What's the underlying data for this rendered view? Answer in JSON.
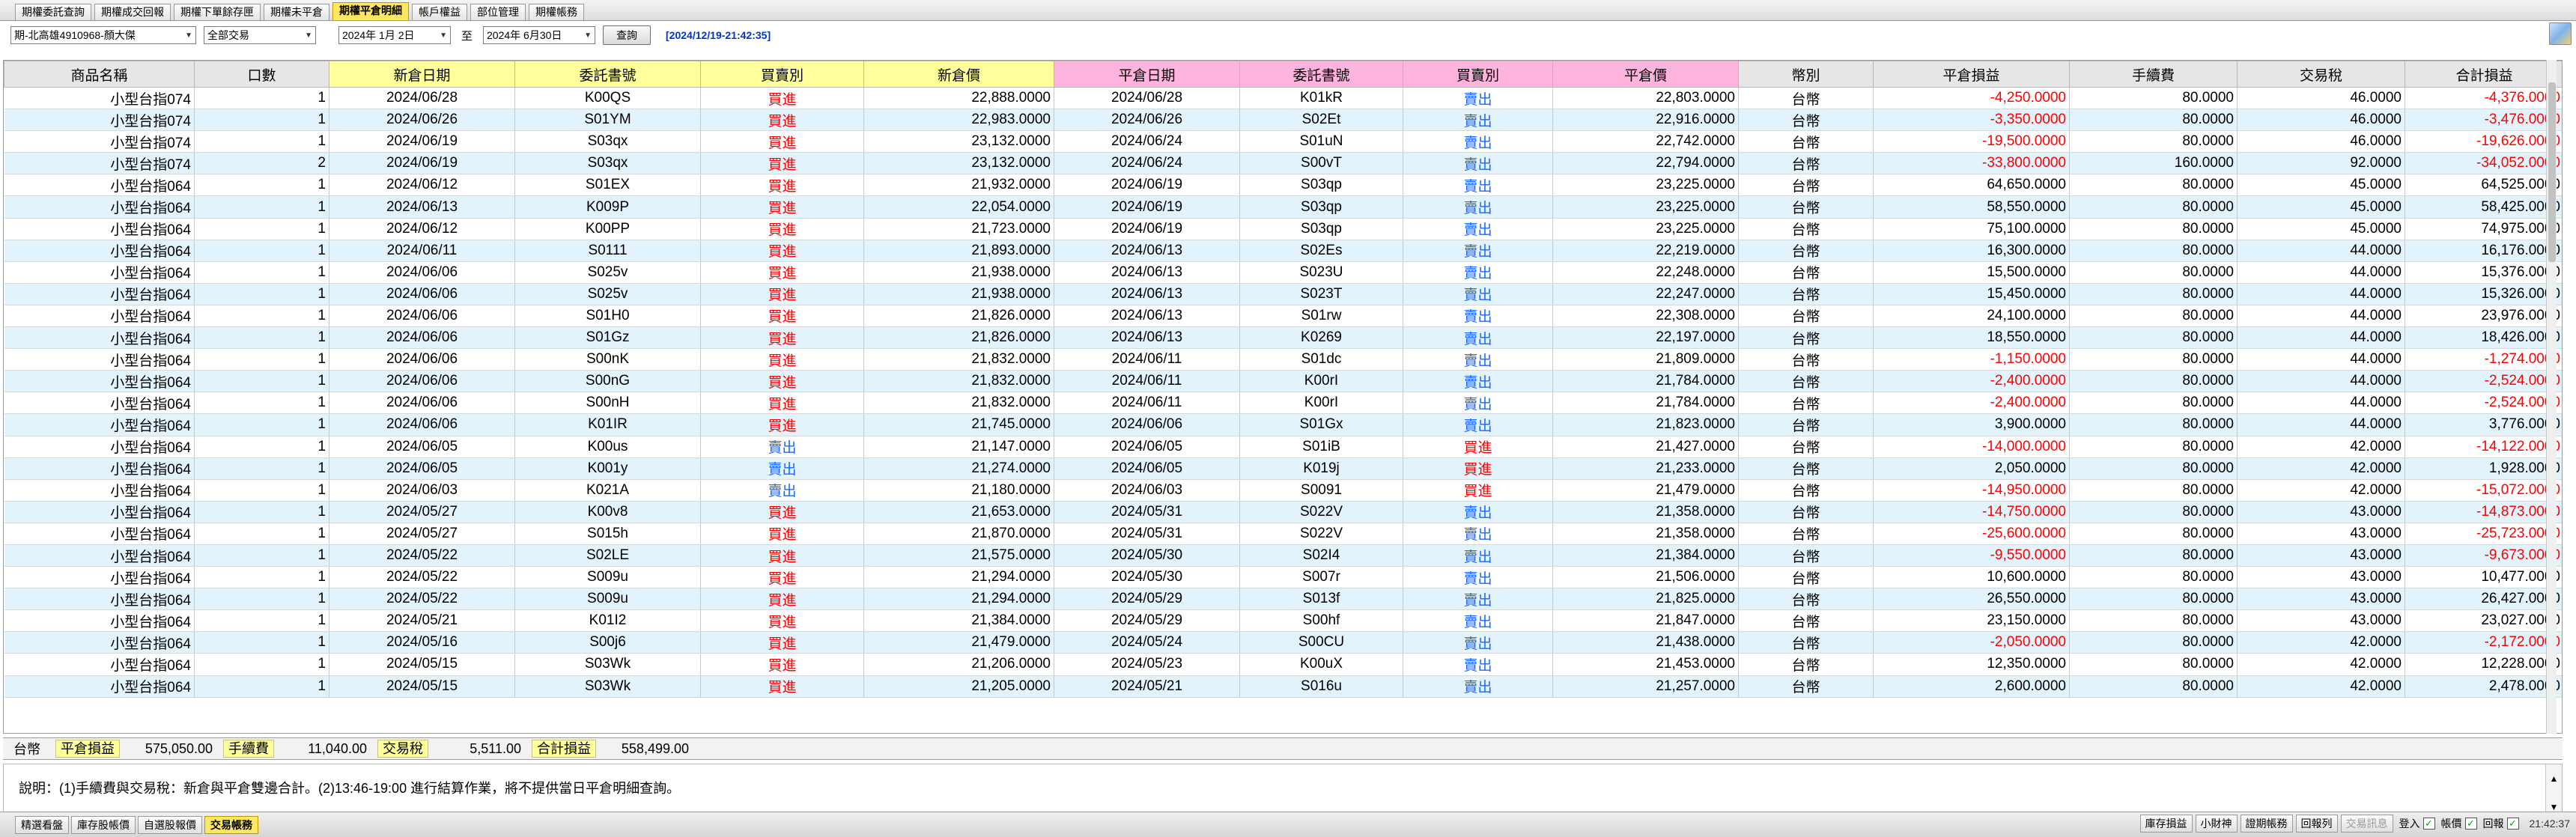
{
  "top_tabs": [
    "期權委託查詢",
    "期權成交回報",
    "期權下單餘存匣",
    "期權未平倉",
    "期權平倉明細",
    "帳戶權益",
    "部位管理",
    "期權帳務"
  ],
  "active_top_tab": "期權平倉明細",
  "toolbar": {
    "account": "期-北高雄4910968-顏大傑",
    "trade_type": "全部交易",
    "date_from": "2024年 1月 2日",
    "tilde": "至",
    "date_to": "2024年 6月30日",
    "query_label": "查詢",
    "timestamp": "[2024/12/19-21:42:35]"
  },
  "columns": [
    "商品名稱",
    "口數",
    "新倉日期",
    "委託書號",
    "買賣別",
    "新倉價",
    "平倉日期",
    "委託書號",
    "買賣別",
    "平倉價",
    "幣別",
    "平倉損益",
    "手續費",
    "交易稅",
    "合計損益"
  ],
  "rows": [
    [
      "小型台指074",
      "1",
      "2024/06/28",
      "K00QS",
      "買進",
      "22,888.0000",
      "2024/06/28",
      "K01kR",
      "賣出",
      "22,803.0000",
      "台幣",
      "-4,250.0000",
      "80.0000",
      "46.0000",
      "-4,376.0000"
    ],
    [
      "小型台指074",
      "1",
      "2024/06/26",
      "S01YM",
      "買進",
      "22,983.0000",
      "2024/06/26",
      "S02Et",
      "賣出",
      "22,916.0000",
      "台幣",
      "-3,350.0000",
      "80.0000",
      "46.0000",
      "-3,476.0000"
    ],
    [
      "小型台指074",
      "1",
      "2024/06/19",
      "S03qx",
      "買進",
      "23,132.0000",
      "2024/06/24",
      "S01uN",
      "賣出",
      "22,742.0000",
      "台幣",
      "-19,500.0000",
      "80.0000",
      "46.0000",
      "-19,626.0000"
    ],
    [
      "小型台指074",
      "2",
      "2024/06/19",
      "S03qx",
      "買進",
      "23,132.0000",
      "2024/06/24",
      "S00vT",
      "賣出",
      "22,794.0000",
      "台幣",
      "-33,800.0000",
      "160.0000",
      "92.0000",
      "-34,052.0000"
    ],
    [
      "小型台指064",
      "1",
      "2024/06/12",
      "S01EX",
      "買進",
      "21,932.0000",
      "2024/06/19",
      "S03qp",
      "賣出",
      "23,225.0000",
      "台幣",
      "64,650.0000",
      "80.0000",
      "45.0000",
      "64,525.0000"
    ],
    [
      "小型台指064",
      "1",
      "2024/06/13",
      "K009P",
      "買進",
      "22,054.0000",
      "2024/06/19",
      "S03qp",
      "賣出",
      "23,225.0000",
      "台幣",
      "58,550.0000",
      "80.0000",
      "45.0000",
      "58,425.0000"
    ],
    [
      "小型台指064",
      "1",
      "2024/06/12",
      "K00PP",
      "買進",
      "21,723.0000",
      "2024/06/19",
      "S03qp",
      "賣出",
      "23,225.0000",
      "台幣",
      "75,100.0000",
      "80.0000",
      "45.0000",
      "74,975.0000"
    ],
    [
      "小型台指064",
      "1",
      "2024/06/11",
      "S0111",
      "買進",
      "21,893.0000",
      "2024/06/13",
      "S02Es",
      "賣出",
      "22,219.0000",
      "台幣",
      "16,300.0000",
      "80.0000",
      "44.0000",
      "16,176.0000"
    ],
    [
      "小型台指064",
      "1",
      "2024/06/06",
      "S025v",
      "買進",
      "21,938.0000",
      "2024/06/13",
      "S023U",
      "賣出",
      "22,248.0000",
      "台幣",
      "15,500.0000",
      "80.0000",
      "44.0000",
      "15,376.0000"
    ],
    [
      "小型台指064",
      "1",
      "2024/06/06",
      "S025v",
      "買進",
      "21,938.0000",
      "2024/06/13",
      "S023T",
      "賣出",
      "22,247.0000",
      "台幣",
      "15,450.0000",
      "80.0000",
      "44.0000",
      "15,326.0000"
    ],
    [
      "小型台指064",
      "1",
      "2024/06/06",
      "S01H0",
      "買進",
      "21,826.0000",
      "2024/06/13",
      "S01rw",
      "賣出",
      "22,308.0000",
      "台幣",
      "24,100.0000",
      "80.0000",
      "44.0000",
      "23,976.0000"
    ],
    [
      "小型台指064",
      "1",
      "2024/06/06",
      "S01Gz",
      "買進",
      "21,826.0000",
      "2024/06/13",
      "K0269",
      "賣出",
      "22,197.0000",
      "台幣",
      "18,550.0000",
      "80.0000",
      "44.0000",
      "18,426.0000"
    ],
    [
      "小型台指064",
      "1",
      "2024/06/06",
      "S00nK",
      "買進",
      "21,832.0000",
      "2024/06/11",
      "S01dc",
      "賣出",
      "21,809.0000",
      "台幣",
      "-1,150.0000",
      "80.0000",
      "44.0000",
      "-1,274.0000"
    ],
    [
      "小型台指064",
      "1",
      "2024/06/06",
      "S00nG",
      "買進",
      "21,832.0000",
      "2024/06/11",
      "K00rI",
      "賣出",
      "21,784.0000",
      "台幣",
      "-2,400.0000",
      "80.0000",
      "44.0000",
      "-2,524.0000"
    ],
    [
      "小型台指064",
      "1",
      "2024/06/06",
      "S00nH",
      "買進",
      "21,832.0000",
      "2024/06/11",
      "K00rI",
      "賣出",
      "21,784.0000",
      "台幣",
      "-2,400.0000",
      "80.0000",
      "44.0000",
      "-2,524.0000"
    ],
    [
      "小型台指064",
      "1",
      "2024/06/06",
      "K01IR",
      "買進",
      "21,745.0000",
      "2024/06/06",
      "S01Gx",
      "賣出",
      "21,823.0000",
      "台幣",
      "3,900.0000",
      "80.0000",
      "44.0000",
      "3,776.0000"
    ],
    [
      "小型台指064",
      "1",
      "2024/06/05",
      "K00us",
      "賣出",
      "21,147.0000",
      "2024/06/05",
      "S01iB",
      "買進",
      "21,427.0000",
      "台幣",
      "-14,000.0000",
      "80.0000",
      "42.0000",
      "-14,122.0000"
    ],
    [
      "小型台指064",
      "1",
      "2024/06/05",
      "K001y",
      "賣出",
      "21,274.0000",
      "2024/06/05",
      "K019j",
      "買進",
      "21,233.0000",
      "台幣",
      "2,050.0000",
      "80.0000",
      "42.0000",
      "1,928.0000"
    ],
    [
      "小型台指064",
      "1",
      "2024/06/03",
      "K021A",
      "賣出",
      "21,180.0000",
      "2024/06/03",
      "S0091",
      "買進",
      "21,479.0000",
      "台幣",
      "-14,950.0000",
      "80.0000",
      "42.0000",
      "-15,072.0000"
    ],
    [
      "小型台指064",
      "1",
      "2024/05/27",
      "K00v8",
      "買進",
      "21,653.0000",
      "2024/05/31",
      "S022V",
      "賣出",
      "21,358.0000",
      "台幣",
      "-14,750.0000",
      "80.0000",
      "43.0000",
      "-14,873.0000"
    ],
    [
      "小型台指064",
      "1",
      "2024/05/27",
      "S015h",
      "買進",
      "21,870.0000",
      "2024/05/31",
      "S022V",
      "賣出",
      "21,358.0000",
      "台幣",
      "-25,600.0000",
      "80.0000",
      "43.0000",
      "-25,723.0000"
    ],
    [
      "小型台指064",
      "1",
      "2024/05/22",
      "S02LE",
      "買進",
      "21,575.0000",
      "2024/05/30",
      "S02I4",
      "賣出",
      "21,384.0000",
      "台幣",
      "-9,550.0000",
      "80.0000",
      "43.0000",
      "-9,673.0000"
    ],
    [
      "小型台指064",
      "1",
      "2024/05/22",
      "S009u",
      "買進",
      "21,294.0000",
      "2024/05/30",
      "S007r",
      "賣出",
      "21,506.0000",
      "台幣",
      "10,600.0000",
      "80.0000",
      "43.0000",
      "10,477.0000"
    ],
    [
      "小型台指064",
      "1",
      "2024/05/22",
      "S009u",
      "買進",
      "21,294.0000",
      "2024/05/29",
      "S013f",
      "賣出",
      "21,825.0000",
      "台幣",
      "26,550.0000",
      "80.0000",
      "43.0000",
      "26,427.0000"
    ],
    [
      "小型台指064",
      "1",
      "2024/05/21",
      "K01I2",
      "買進",
      "21,384.0000",
      "2024/05/29",
      "S00hf",
      "賣出",
      "21,847.0000",
      "台幣",
      "23,150.0000",
      "80.0000",
      "43.0000",
      "23,027.0000"
    ],
    [
      "小型台指064",
      "1",
      "2024/05/16",
      "S00j6",
      "買進",
      "21,479.0000",
      "2024/05/24",
      "S00CU",
      "賣出",
      "21,438.0000",
      "台幣",
      "-2,050.0000",
      "80.0000",
      "42.0000",
      "-2,172.0000"
    ],
    [
      "小型台指064",
      "1",
      "2024/05/15",
      "S03Wk",
      "買進",
      "21,206.0000",
      "2024/05/23",
      "K00uX",
      "賣出",
      "21,453.0000",
      "台幣",
      "12,350.0000",
      "80.0000",
      "42.0000",
      "12,228.0000"
    ],
    [
      "小型台指064",
      "1",
      "2024/05/15",
      "S03Wk",
      "買進",
      "21,205.0000",
      "2024/05/21",
      "S016u",
      "賣出",
      "21,257.0000",
      "台幣",
      "2,600.0000",
      "80.0000",
      "42.0000",
      "2,478.0000"
    ]
  ],
  "summary": {
    "currency": "台幣",
    "pl_label": "平倉損益",
    "pl_value": "575,050.00",
    "fee_label": "手續費",
    "fee_value": "11,040.00",
    "tax_label": "交易稅",
    "tax_value": "5,511.00",
    "total_label": "合計損益",
    "total_value": "558,499.00"
  },
  "note": "說明：(1)手續費與交易稅：新倉與平倉雙邊合計。(2)13:46-19:00 進行結算作業，將不提供當日平倉明細查詢。",
  "bottom_tabs": [
    "精選看盤",
    "庫存股帳價",
    "自選股報價",
    "交易帳務"
  ],
  "active_bottom_tab": "交易帳務",
  "status_buttons": [
    "庫存損益",
    "小財神",
    "證期帳務",
    "回報列",
    "交易訊息"
  ],
  "status_checks": [
    "登入",
    "帳價",
    "回報"
  ],
  "clock": "21:42:37",
  "colors": {
    "buy": "#ff0000",
    "sell": "#1a66ff",
    "negative": "#ff0000",
    "row_alt": "#e2f3fc",
    "header_yellow": "#ffff9c",
    "header_pink": "#ffb4dd",
    "active_tab": "#ffe766",
    "timestamp": "#0033cc"
  },
  "icons": [
    "window-corner-icon",
    "dropdown-arrow-icon",
    "checkbox-checked-icon",
    "scroll-up-icon",
    "scroll-down-icon"
  ]
}
